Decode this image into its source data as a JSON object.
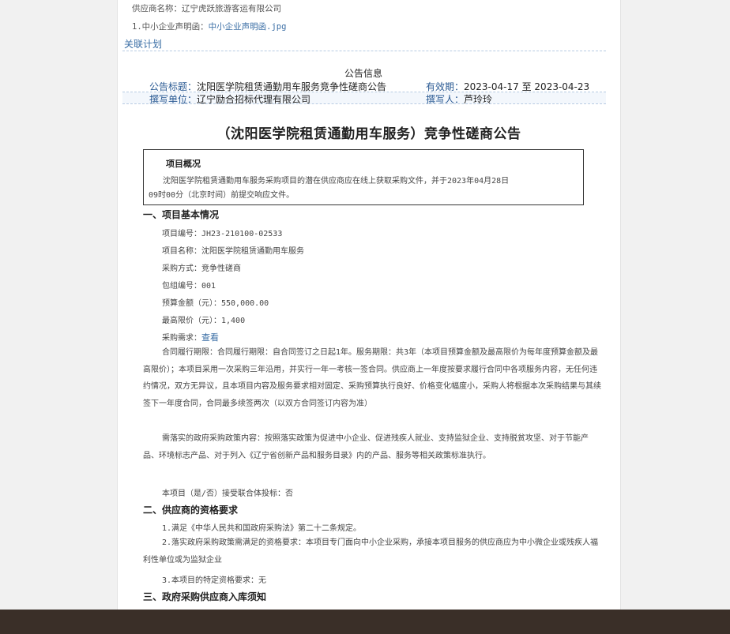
{
  "top": {
    "supplier_line": "供应商名称：辽宁虎跃旅游客运有限公司",
    "attachment_label": "1.中小企业声明函：",
    "attachment_file": "中小企业声明函.jpg",
    "related_plan": "关联计划"
  },
  "info": {
    "header": "公告信息",
    "title_label": "公告标题：",
    "title_value": "沈阳医学院租赁通勤用车服务竞争性磋商公告",
    "validity_label": "有效期：",
    "validity_from": "2023-04-17",
    "validity_to_word": "至",
    "validity_to": "2023-04-23",
    "author_unit_label": "撰写单位：",
    "author_unit_value": "辽宁励合招标代理有限公司",
    "author_label": "撰写人：",
    "author_value": "芦玲玲"
  },
  "doc": {
    "main_title": "（沈阳医学院租赁通勤用车服务）竞争性磋商公告",
    "overview_heading": "项目概况",
    "overview_line1": "沈阳医学院租赁通勤用车服务采购项目的潜在供应商应在线上获取采购文件，并于2023年04月28日",
    "overview_line2": "09时00分（北京时间）前提交响应文件。",
    "section1": "一、项目基本情况",
    "project_no": "项目编号：JH23-210100-02533",
    "project_name": "项目名称：沈阳医学院租赁通勤用车服务",
    "method": "采购方式：竞争性磋商",
    "package_no": "包组编号：001",
    "budget": "预算金额（元）：550,000.00",
    "max_price": "最高限价（元）：1,400",
    "requirement_label": "采购需求：",
    "requirement_link": "查看",
    "contract_period": "合同履行期限：合同履行期限：自合同签订之日起1年。服务期限：共3年（本项目预算金额及最高限价为每年度预算金额及最高限价）；本项目采用一次采购三年沿用，并实行一年一考核一签合同。供应商上一年度按要求履行合同中各项服务内容，无任何违约情况，双方无异议，且本项目内容及服务要求相对固定、采购预算执行良好、价格变化幅度小，采购人将根据本次采购结果与其续签下一年度合同，合同最多续签两次（以双方合同签订内容为准）",
    "policy": "需落实的政府采购政策内容：按照落实政策为促进中小企业、促进残疾人就业、支持监狱企业、支持脱贫攻坚、对于节能产品、环境标志产品、对于列入《辽宁省创新产品和服务目录》内的产品、服务等相关政策标准执行。",
    "joint_bid": "本项目（是/否）接受联合体投标：否",
    "section2": "二、供应商的资格要求",
    "req1": "1.满足《中华人民共和国政府采购法》第二十二条规定。",
    "req2": "2.落实政府采购政策需满足的资格要求：本项目专门面向中小企业采购，承接本项目服务的供应商应为中小微企业或残疾人福利性单位或为监狱企业",
    "req3": "3.本项目的特定资格要求：无",
    "section3": "三、政府采购供应商入库须知"
  }
}
